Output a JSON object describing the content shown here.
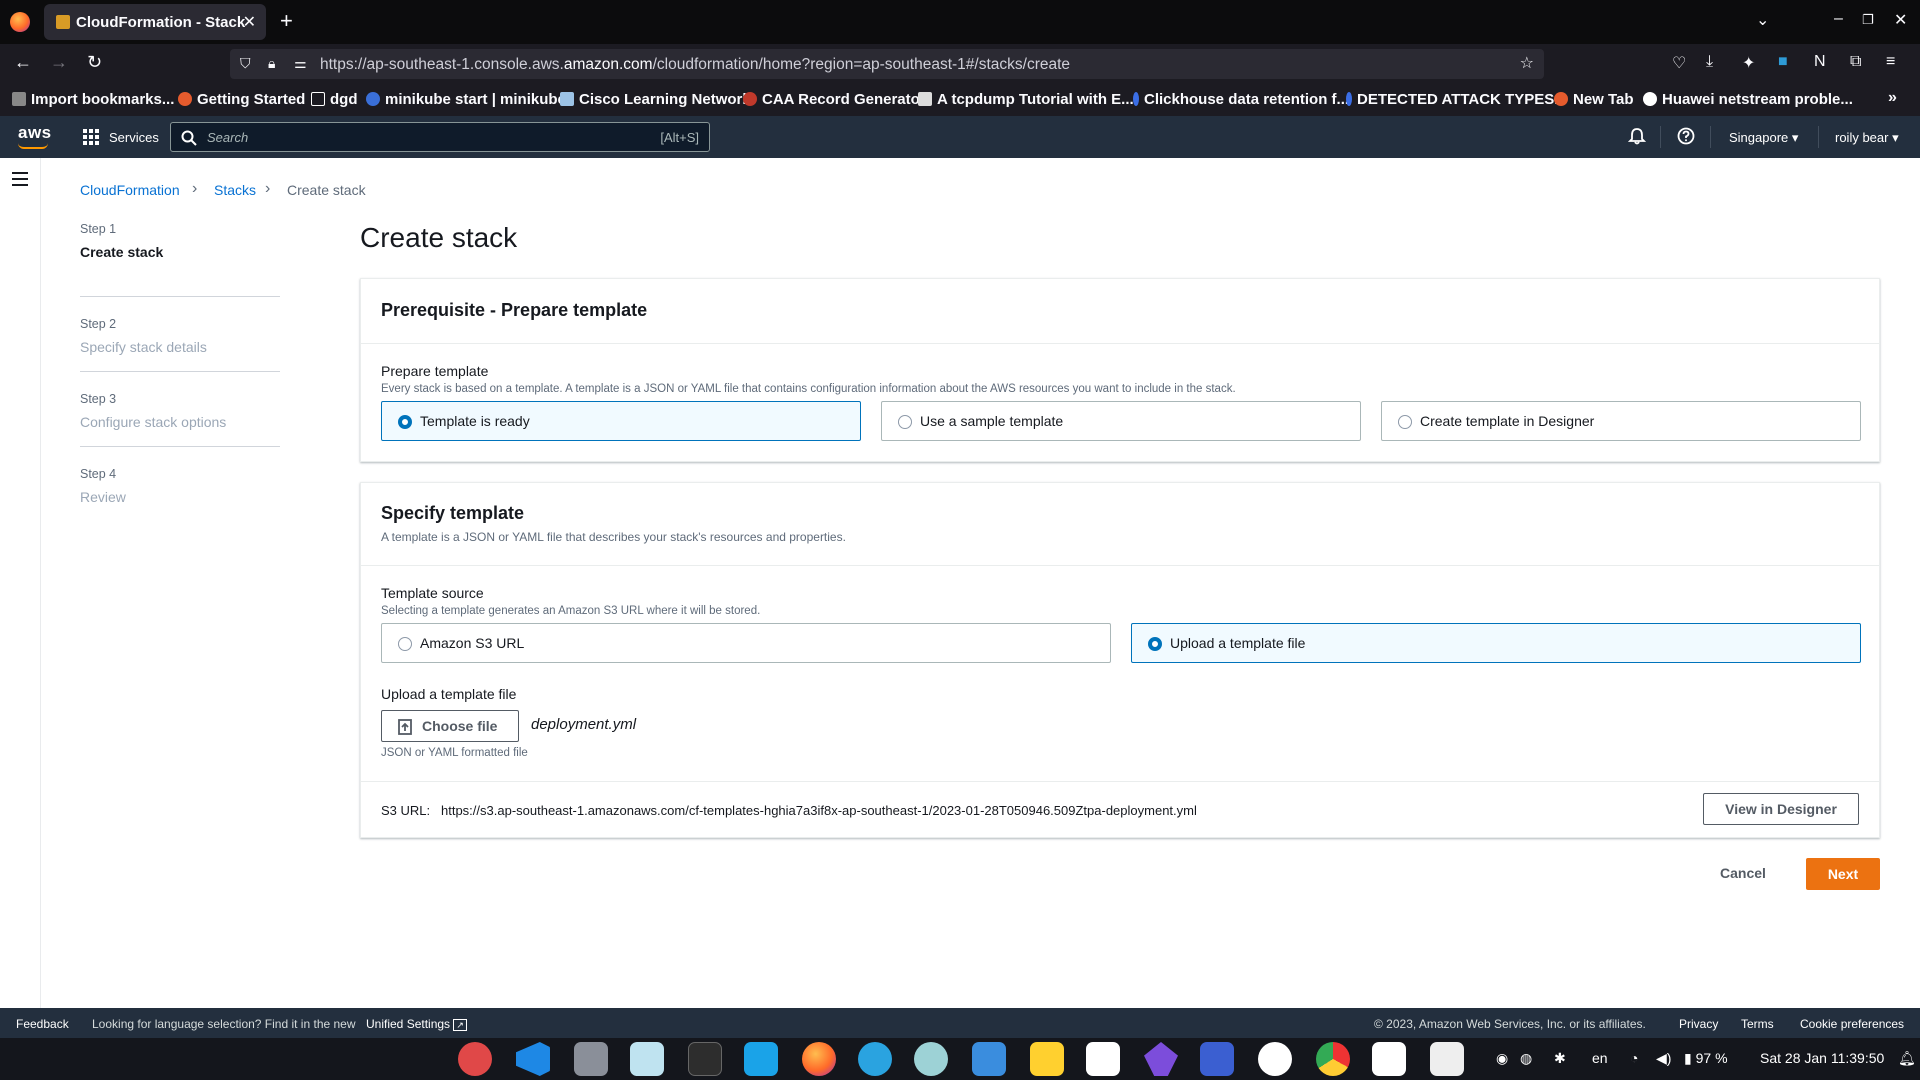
{
  "browser": {
    "tab_title": "CloudFormation - Stack",
    "url_prefix": "https://ap-southeast-1.console.aws.",
    "url_domain": "amazon.com",
    "url_path": "/cloudformation/home?region=ap-southeast-1#/stacks/create",
    "bookmarks": [
      {
        "label": "Import bookmarks...",
        "icon": "import-icon"
      },
      {
        "label": "Getting Started",
        "icon": "firefox-icon"
      },
      {
        "label": "dgd",
        "icon": "folder-icon"
      },
      {
        "label": "minikube start | minikube",
        "icon": "minikube-icon"
      },
      {
        "label": "Cisco Learning Network",
        "icon": "cisco-icon"
      },
      {
        "label": "CAA Record Generator",
        "icon": "caa-icon"
      },
      {
        "label": "A tcpdump Tutorial with E...",
        "icon": "tcpdump-icon"
      },
      {
        "label": "Clickhouse data retention f...",
        "icon": "clickhouse-icon"
      },
      {
        "label": "DETECTED ATTACK TYPES...",
        "icon": "attack-icon"
      },
      {
        "label": "New Tab",
        "icon": "firefox-icon"
      },
      {
        "label": "Huawei netstream proble...",
        "icon": "github-icon"
      }
    ]
  },
  "aws_header": {
    "logo": "aws",
    "services_label": "Services",
    "search_placeholder": "Search",
    "search_shortcut": "[Alt+S]",
    "region": "Singapore",
    "user": "roily bear"
  },
  "breadcrumbs": [
    "CloudFormation",
    "Stacks",
    "Create stack"
  ],
  "steps": [
    {
      "number": "Step 1",
      "title": "Create stack",
      "active": true
    },
    {
      "number": "Step 2",
      "title": "Specify stack details",
      "active": false
    },
    {
      "number": "Step 3",
      "title": "Configure stack options",
      "active": false
    },
    {
      "number": "Step 4",
      "title": "Review",
      "active": false
    }
  ],
  "page_title": "Create stack",
  "prerequisite": {
    "heading": "Prerequisite - Prepare template",
    "field_label": "Prepare template",
    "field_desc": "Every stack is based on a template. A template is a JSON or YAML file that contains configuration information about the AWS resources you want to include in the stack.",
    "options": [
      "Template is ready",
      "Use a sample template",
      "Create template in Designer"
    ],
    "selected": "Template is ready"
  },
  "specify": {
    "heading": "Specify template",
    "subheading": "A template is a JSON or YAML file that describes your stack's resources and properties.",
    "source_label": "Template source",
    "source_desc": "Selecting a template generates an Amazon S3 URL where it will be stored.",
    "options": [
      "Amazon S3 URL",
      "Upload a template file"
    ],
    "selected": "Upload a template file",
    "upload_label": "Upload a template file",
    "choose_button": "Choose file",
    "file_name": "deployment.yml",
    "upload_hint": "JSON or YAML formatted file",
    "s3_label": "S3 URL:",
    "s3_url": "https://s3.ap-southeast-1.amazonaws.com/cf-templates-hghia7a3if8x-ap-southeast-1/2023-01-28T050946.509Ztpa-deployment.yml",
    "view_designer": "View in Designer"
  },
  "actions": {
    "cancel": "Cancel",
    "next": "Next"
  },
  "footer": {
    "feedback": "Feedback",
    "lang_note": "Looking for language selection? Find it in the new",
    "unified": "Unified Settings",
    "copyright": "© 2023, Amazon Web Services, Inc. or its affiliates.",
    "privacy": "Privacy",
    "terms": "Terms",
    "cookies": "Cookie preferences"
  },
  "taskbar": {
    "apps": [
      "tool-icon",
      "vscode-icon",
      "files-icon",
      "reader-icon",
      "terminal-icon",
      "remote-icon",
      "firefox-icon",
      "telegram-icon",
      "paw-icon",
      "scanner-icon",
      "miro-icon",
      "clickup-icon",
      "obsidian-icon",
      "pdf-icon",
      "slack-icon",
      "chrome-icon",
      "typora-icon",
      "editor-icon"
    ],
    "lang": "en",
    "battery": "97 %",
    "clock": "Sat 28 Jan  11:39:50"
  },
  "colors": {
    "aws_nav": "#232f3e",
    "link": "#0972d3",
    "primary": "#ec7211",
    "selected": "#0073bb"
  }
}
